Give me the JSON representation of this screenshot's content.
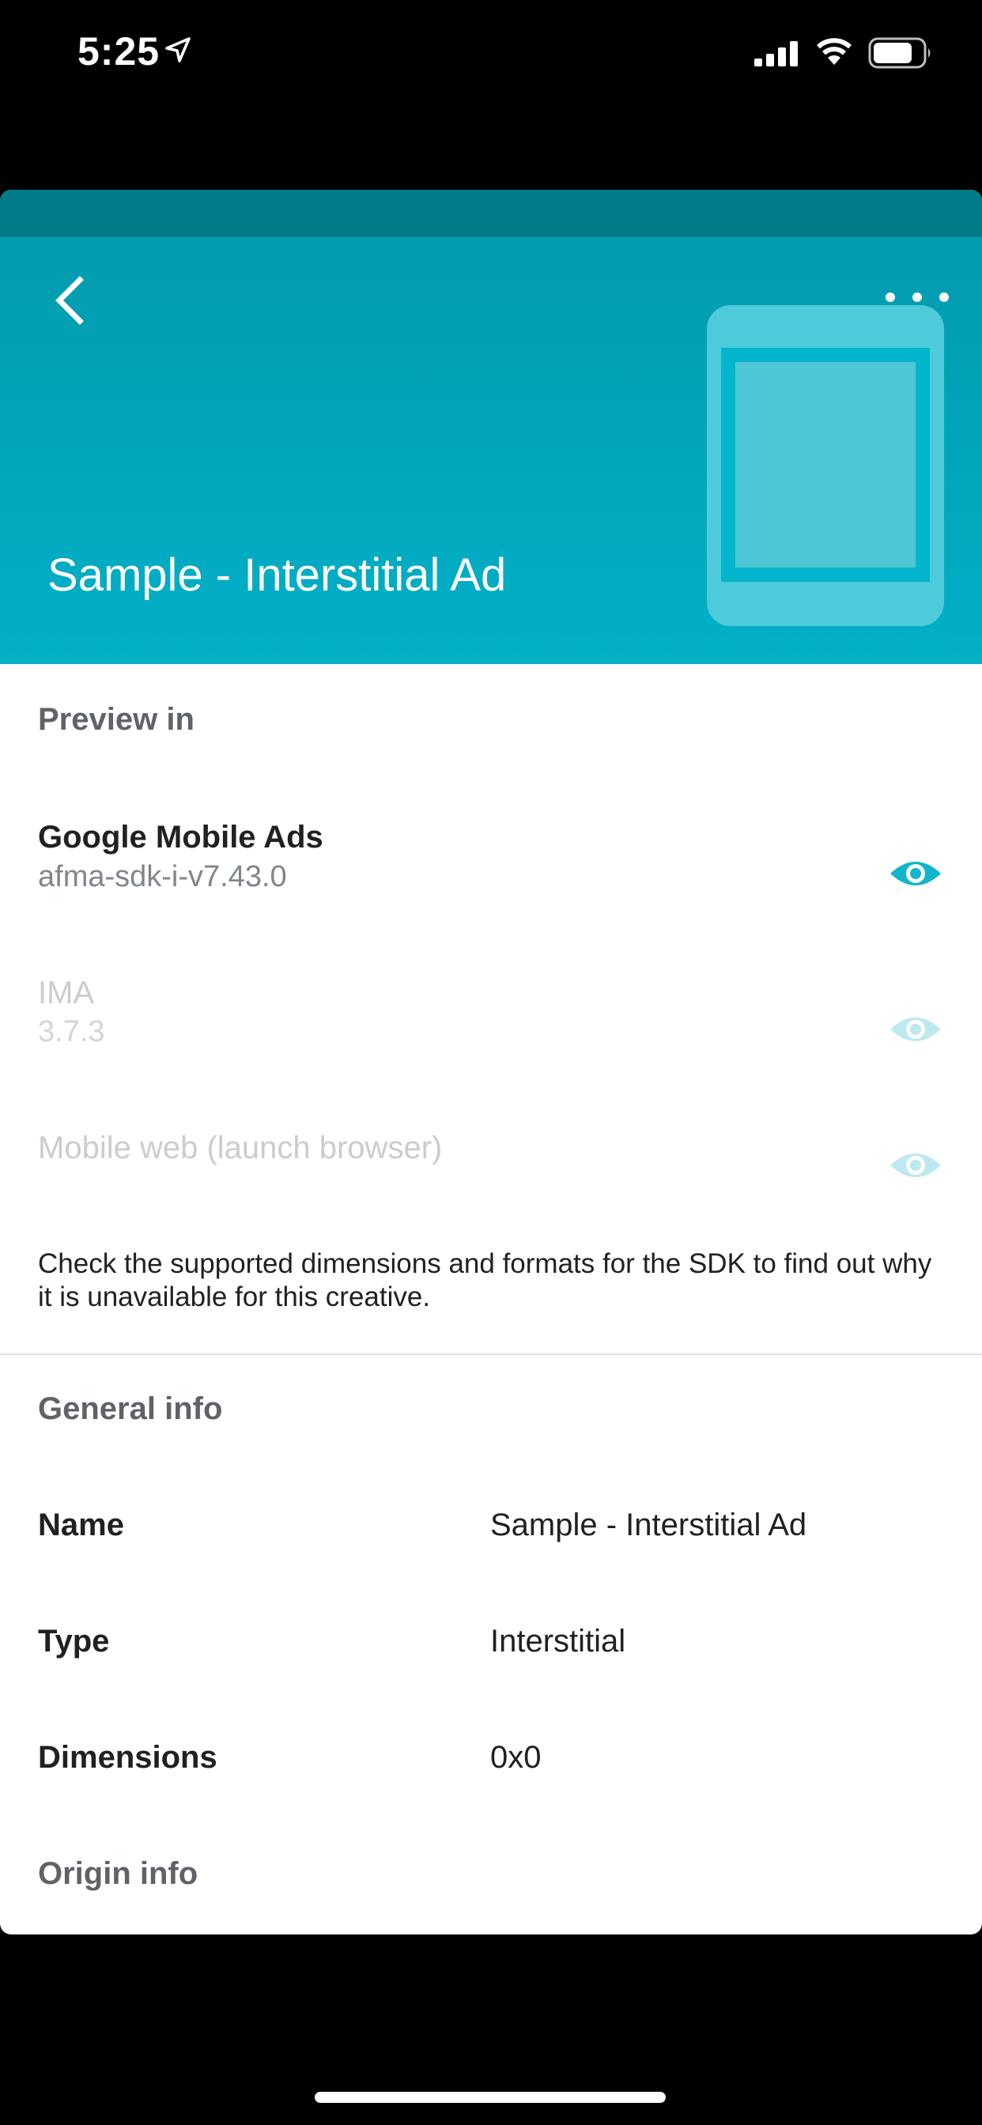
{
  "status_bar": {
    "time": "5:25"
  },
  "header": {
    "title": "Sample - Interstitial Ad",
    "accent_color": "#02B0C8"
  },
  "preview": {
    "section_title": "Preview in",
    "sdks": [
      {
        "name": "Google Mobile Ads",
        "version": "afma-sdk-i-v7.43.0",
        "enabled": true
      },
      {
        "name": "IMA",
        "version": "3.7.3",
        "enabled": false
      },
      {
        "name": "Mobile web (launch browser)",
        "version": "",
        "enabled": false
      }
    ],
    "help_text": "Check the supported dimensions and formats for the SDK to find out why it is unavailable for this creative."
  },
  "general_info": {
    "section_title": "General info",
    "rows": [
      {
        "label": "Name",
        "value": "Sample - Interstitial Ad"
      },
      {
        "label": "Type",
        "value": "Interstitial"
      },
      {
        "label": "Dimensions",
        "value": "0x0"
      }
    ]
  },
  "origin_info": {
    "section_title": "Origin info"
  }
}
